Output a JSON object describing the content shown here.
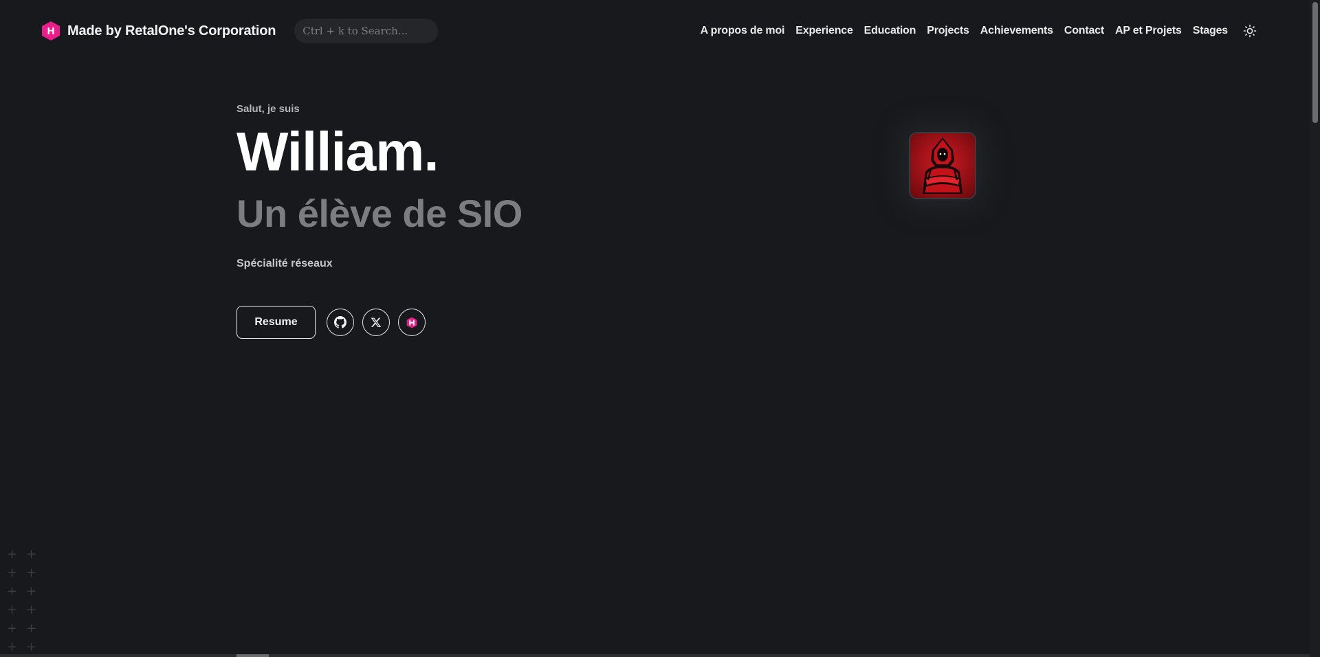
{
  "header": {
    "brand_name": "Made by RetalOne's Corporation",
    "logo_letter": "H",
    "search_placeholder": "Ctrl + k to Search...",
    "nav": [
      "A propos de moi",
      "Experience",
      "Education",
      "Projects",
      "Achievements",
      "Contact",
      "AP et Projets",
      "Stages"
    ],
    "theme_icon": "sun-icon"
  },
  "hero": {
    "greeting": "Salut, je suis",
    "name": "William.",
    "role": "Un élève de SIO",
    "speciality": "Spécialité réseaux",
    "resume_label": "Resume",
    "socials": [
      "github-icon",
      "x-twitter-icon",
      "hugo-icon"
    ]
  },
  "colors": {
    "background": "#18191c",
    "accent_pink": "#e91e8c",
    "avatar_red": "#c0161d"
  }
}
